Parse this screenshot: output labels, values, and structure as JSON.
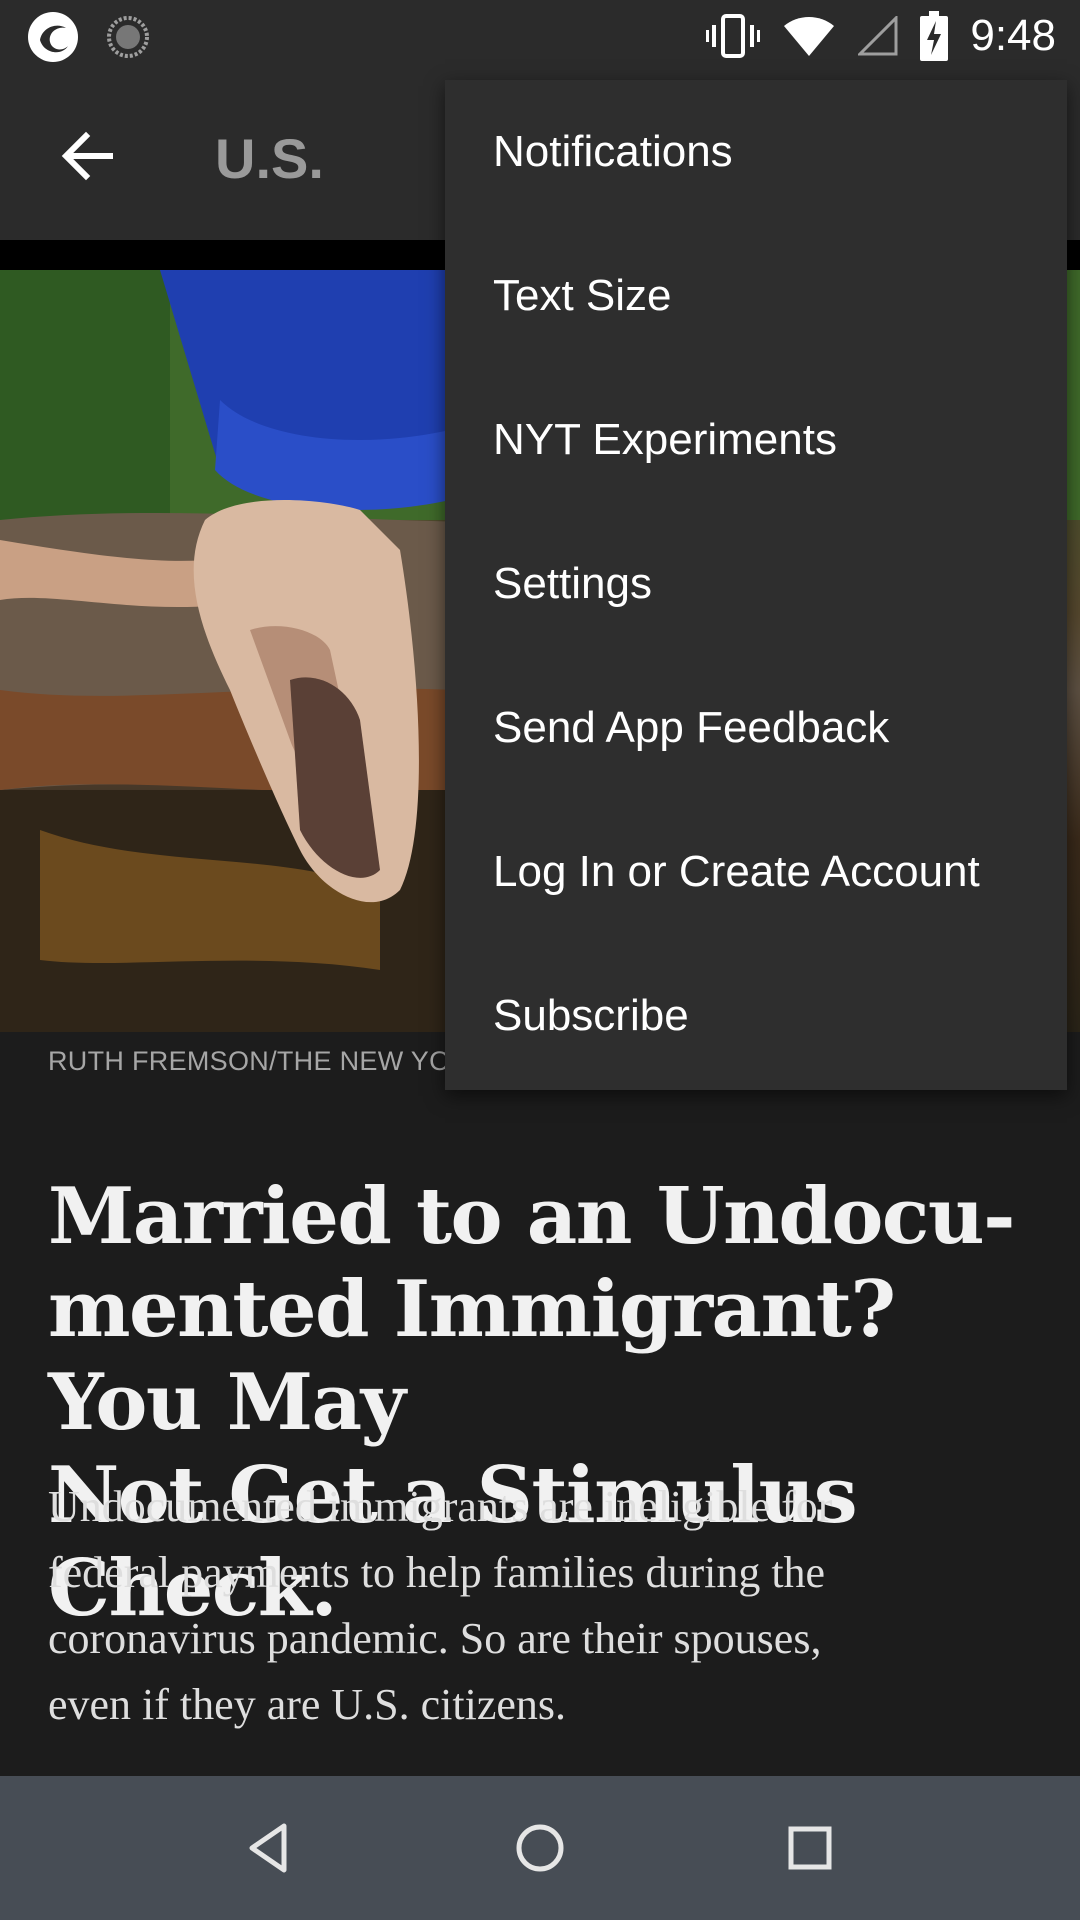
{
  "status_bar": {
    "time": "9:48",
    "icons": [
      "app-logo-icon",
      "sync-icon",
      "vibrate-icon",
      "wifi-icon",
      "cell-signal-icon",
      "battery-charging-icon"
    ]
  },
  "app_bar": {
    "section_title": "U.S.",
    "back_icon": "arrow-left-icon"
  },
  "article": {
    "photo_credit": "RUTH FREMSON/THE NEW YO",
    "headline_lines": [
      "Married to an Undocu-",
      "mented Immigrant? You May",
      "Not Get a Stimulus Check."
    ],
    "summary_lines": [
      "Undocumented immigrants are ineligible for",
      "federal payments to help families during the",
      "coronavirus pandemic. So are their spouses,",
      "even if they are U.S. citizens."
    ]
  },
  "menu": {
    "items": [
      {
        "label": "Notifications"
      },
      {
        "label": "Text Size"
      },
      {
        "label": "NYT Experiments"
      },
      {
        "label": "Settings"
      },
      {
        "label": "Send App Feedback"
      },
      {
        "label": "Log In or Create Account"
      },
      {
        "label": "Subscribe"
      }
    ]
  },
  "nav_bar": {
    "icons": [
      "back-triangle-icon",
      "home-circle-icon",
      "recents-square-icon"
    ]
  }
}
